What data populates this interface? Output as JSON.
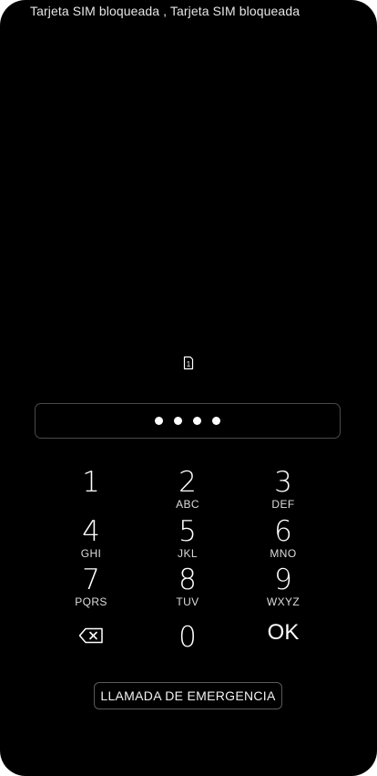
{
  "status_bar": {
    "carrier_text": "Tarjeta SIM bloqueada , Tarjeta SIM bloqueada"
  },
  "sim": {
    "icon": "sim-card-1-icon",
    "slot_label": "1"
  },
  "pin": {
    "entered_digits_count": 4
  },
  "keypad": {
    "keys": [
      {
        "digit": "1",
        "letters": ""
      },
      {
        "digit": "2",
        "letters": "ABC"
      },
      {
        "digit": "3",
        "letters": "DEF"
      },
      {
        "digit": "4",
        "letters": "GHI"
      },
      {
        "digit": "5",
        "letters": "JKL"
      },
      {
        "digit": "6",
        "letters": "MNO"
      },
      {
        "digit": "7",
        "letters": "PQRS"
      },
      {
        "digit": "8",
        "letters": "TUV"
      },
      {
        "digit": "9",
        "letters": "WXYZ"
      },
      {
        "digit": "0",
        "letters": ""
      }
    ],
    "backspace_icon": "backspace-icon",
    "ok_label": "OK"
  },
  "emergency_button": {
    "label": "LLAMADA DE EMERGENCIA"
  },
  "colors": {
    "background": "#000000",
    "text": "#ffffff",
    "border": "#4a4a4a"
  }
}
